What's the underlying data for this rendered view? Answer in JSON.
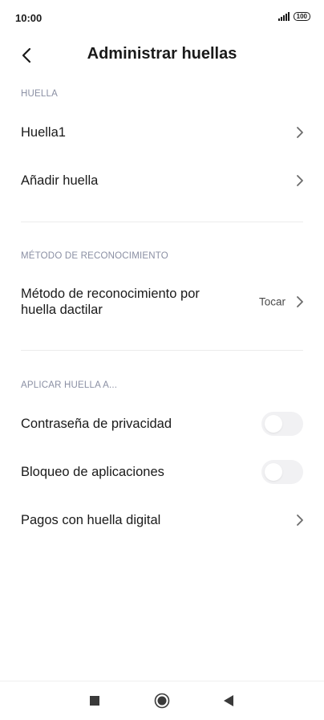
{
  "status_bar": {
    "time": "10:00",
    "battery": "100"
  },
  "header": {
    "title": "Administrar huellas"
  },
  "sections": {
    "huella": {
      "title": "HUELLA",
      "items": [
        {
          "label": "Huella1"
        },
        {
          "label": "Añadir huella"
        }
      ]
    },
    "metodo": {
      "title": "MÉTODO DE RECONOCIMIENTO",
      "item": {
        "label": "Método de reconocimiento por huella dactilar",
        "value": "Tocar"
      }
    },
    "aplicar": {
      "title": "APLICAR HUELLA A...",
      "items": [
        {
          "label": "Contraseña de privacidad",
          "toggle": false
        },
        {
          "label": "Bloqueo de aplicaciones",
          "toggle": false
        },
        {
          "label": "Pagos con huella digital"
        }
      ]
    }
  },
  "colors": {
    "section_header": "#8a8fa3",
    "text": "#1a1a1a",
    "toggle_off": "#f1f1f3",
    "divider": "#ececec"
  },
  "icons": {
    "back": "chevron-left-icon",
    "row": "chevron-right-icon",
    "nav_recents": "square-icon",
    "nav_home": "circle-icon",
    "nav_back": "triangle-left-icon"
  }
}
